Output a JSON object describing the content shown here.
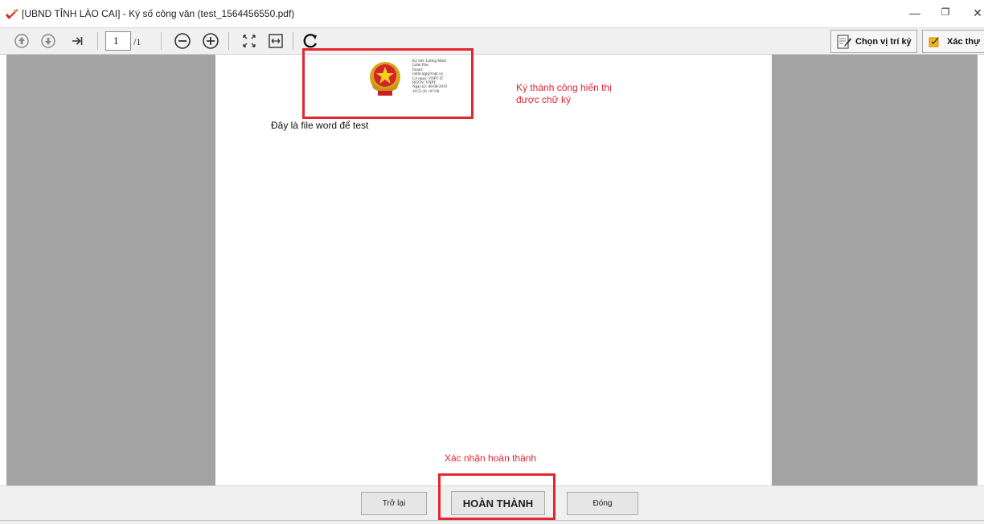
{
  "window": {
    "title": "[UBND TỈNH LÀO CAI] - Ký số công văn (test_1564456550.pdf)",
    "minimize": "—",
    "restore": "❐",
    "close": "✕"
  },
  "toolbar": {
    "page_value": "1",
    "page_total": "/1",
    "choose_position_label": "Chọn vị trí ký",
    "confirm_label": "Xác thự",
    "icons": [
      "page-up-icon",
      "page-down-icon",
      "last-page-icon",
      "zoom-out-icon",
      "zoom-in-icon",
      "fit-page-icon",
      "fit-width-icon",
      "rotate-icon",
      "sign-position-icon",
      "confirm-icon"
    ]
  },
  "document": {
    "signature_lines": [
      "Ký bởi: Lương Minh",
      "Liêm Phụ",
      "Email:",
      "lulml.tgg@vnpt.vn",
      "Cơ quan: VNPT IT",
      "HGOV, VNPT",
      "Ngày ký: 08-08-2019",
      "10:55:16 +07:00"
    ],
    "body_text": "Đây là file word để test"
  },
  "annotations": {
    "signed_note_line1": "Ký thành công hiển thị",
    "signed_note_line2": "được chữ ký",
    "confirm_note": "Xác nhận hoàn thành",
    "highlight_color": "#e3262f"
  },
  "actions": {
    "back_label": "Trở lại",
    "finish_label": "HOÀN THÀNH",
    "close_label": "Đóng"
  },
  "colors": {
    "viewer_background": "#a3a3a3",
    "toolbar_background": "#f0f0f0",
    "accent_red": "#e3262f"
  }
}
